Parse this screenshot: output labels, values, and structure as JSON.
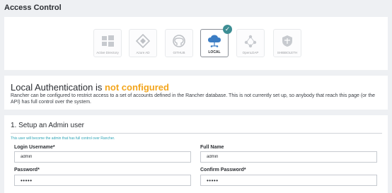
{
  "page_title": "Access Control",
  "providers": [
    {
      "name": "active-directory",
      "label": "Active Directory",
      "icon": "windows-icon",
      "active": false
    },
    {
      "name": "azure-ad",
      "label": "Azure AD",
      "icon": "azure-icon",
      "active": false
    },
    {
      "name": "github",
      "label": "GITHUB",
      "icon": "github-icon",
      "active": false
    },
    {
      "name": "local",
      "label": "LOCAL",
      "icon": "local-icon",
      "active": true
    },
    {
      "name": "openldap",
      "label": "OpenLDAP",
      "icon": "openldap-icon",
      "active": false
    },
    {
      "name": "shibboleth",
      "label": "SHIBBOLETH",
      "icon": "shibboleth-icon",
      "active": false
    }
  ],
  "status": {
    "heading_prefix": "Local Authentication is ",
    "heading_status": "not configured",
    "description": "Rancher can be configured to restrict access to a set of accounts defined in the Rancher database. This is not currently set up, so anybody that reach this page (or the API) has full control over the system."
  },
  "setup": {
    "title": "1. Setup an Admin user",
    "hint": "This user will become the admin that has full control over Rancher.",
    "login_label": "Login Username*",
    "login_value": "admin",
    "fullname_label": "Full Name",
    "fullname_value": "admin",
    "password_label": "Password*",
    "password_value": "admin",
    "confirm_label": "Confirm Password*",
    "confirm_value": "admin"
  },
  "colors": {
    "accent": "#3d8e94",
    "warning": "#f3a51c",
    "hint": "#2fa4b6",
    "background": "#eef0f3"
  }
}
